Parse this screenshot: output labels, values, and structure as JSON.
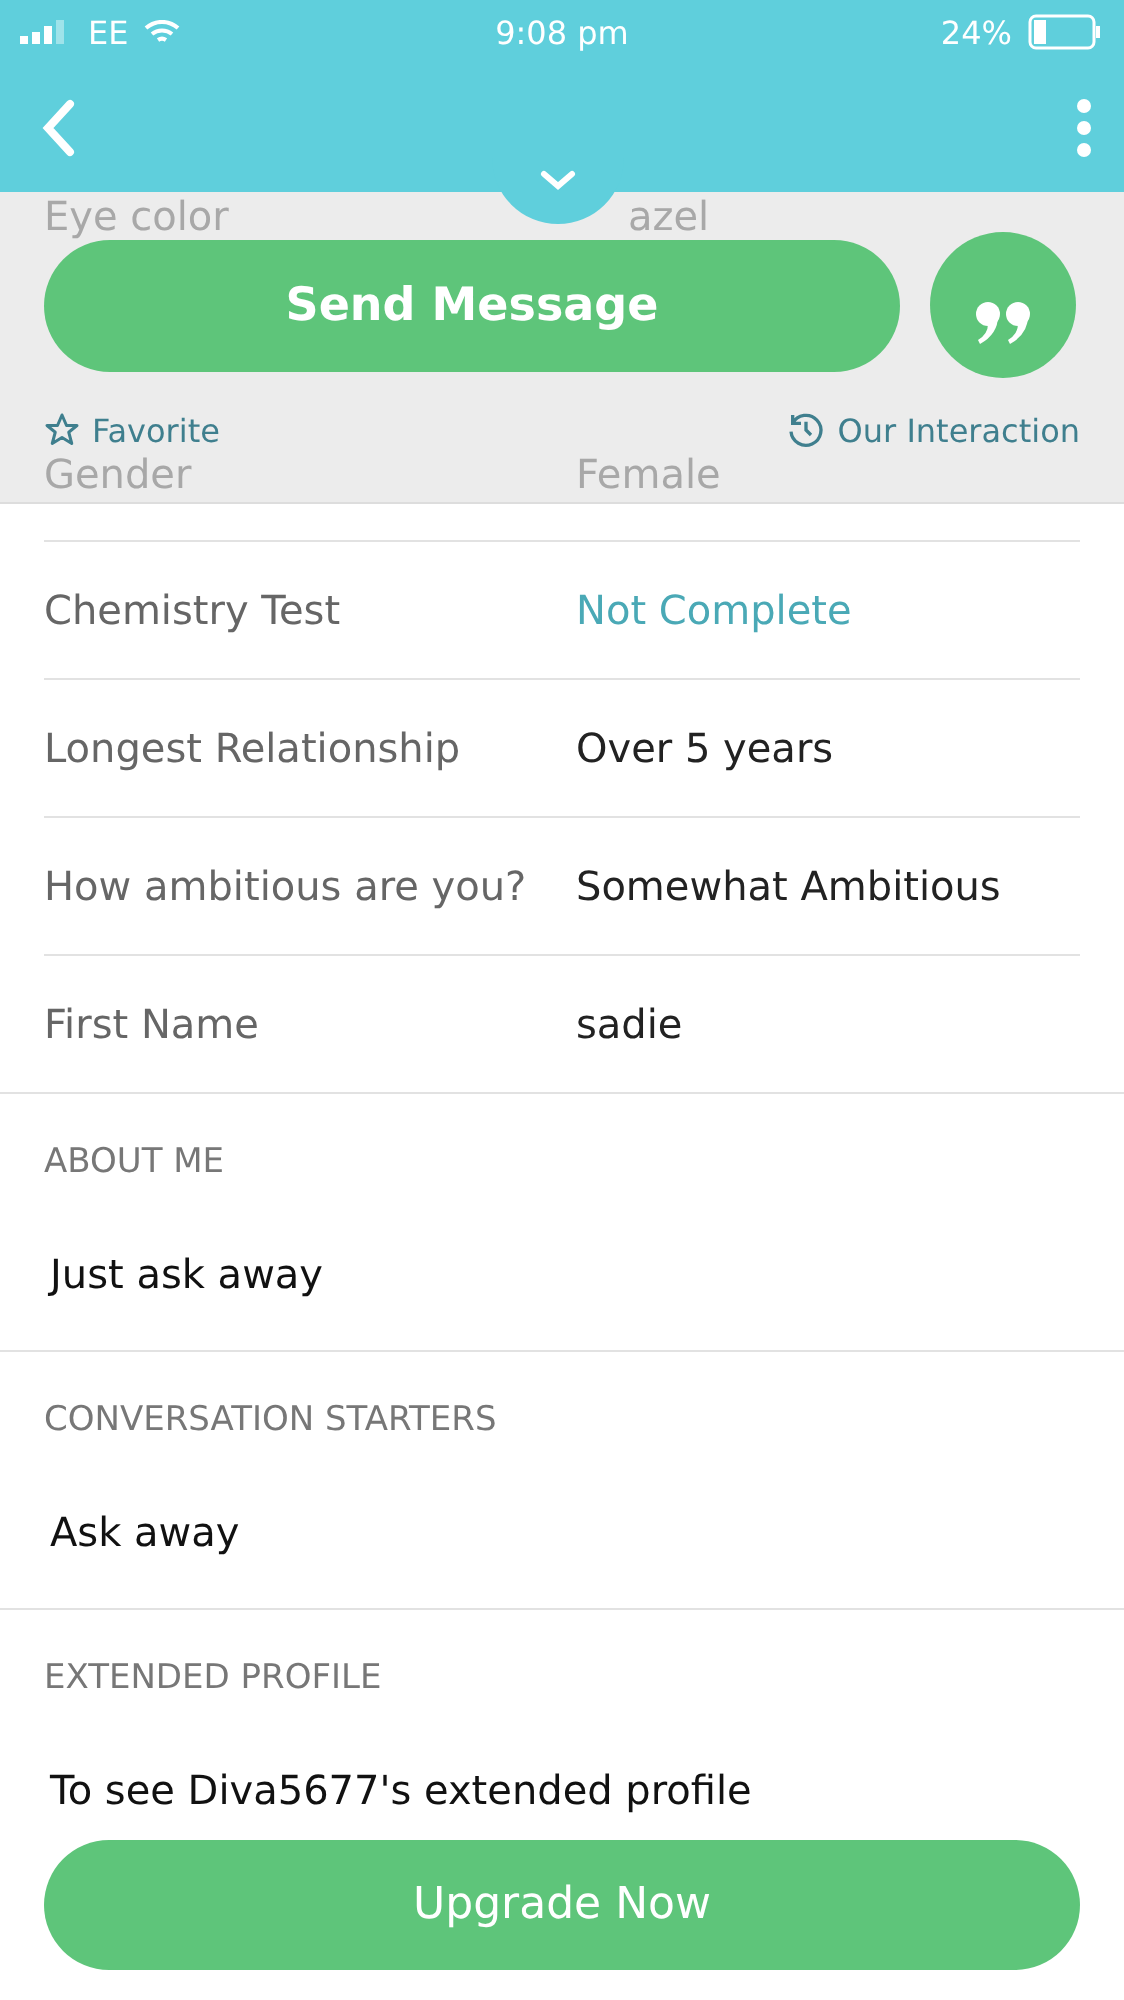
{
  "status_bar": {
    "carrier": "EE",
    "time": "9:08 pm",
    "battery": "24%"
  },
  "overlay": {
    "faded_rows": [
      {
        "label": "Eye color",
        "value": "azel"
      }
    ],
    "send_button": "Send Message",
    "favorite": "Favorite",
    "interaction": "Our Interaction",
    "faded_bottom": {
      "label": "Gender",
      "value": "Female"
    }
  },
  "details": [
    {
      "label": "Chemistry Test",
      "value": "Not Complete",
      "kind": "link"
    },
    {
      "label": "Longest Relationship",
      "value": "Over 5 years",
      "kind": "plain"
    },
    {
      "label": "How ambitious are you?",
      "value": "Somewhat Ambitious",
      "kind": "plain"
    },
    {
      "label": "First Name",
      "value": "sadie",
      "kind": "plain"
    }
  ],
  "sections": [
    {
      "heading": "ABOUT ME",
      "text": "Just ask away"
    },
    {
      "heading": "CONVERSATION STARTERS",
      "text": "Ask away"
    },
    {
      "heading": "EXTENDED PROFILE",
      "text": "To see Diva5677's extended profile"
    }
  ],
  "upgrade_button": "Upgrade Now"
}
